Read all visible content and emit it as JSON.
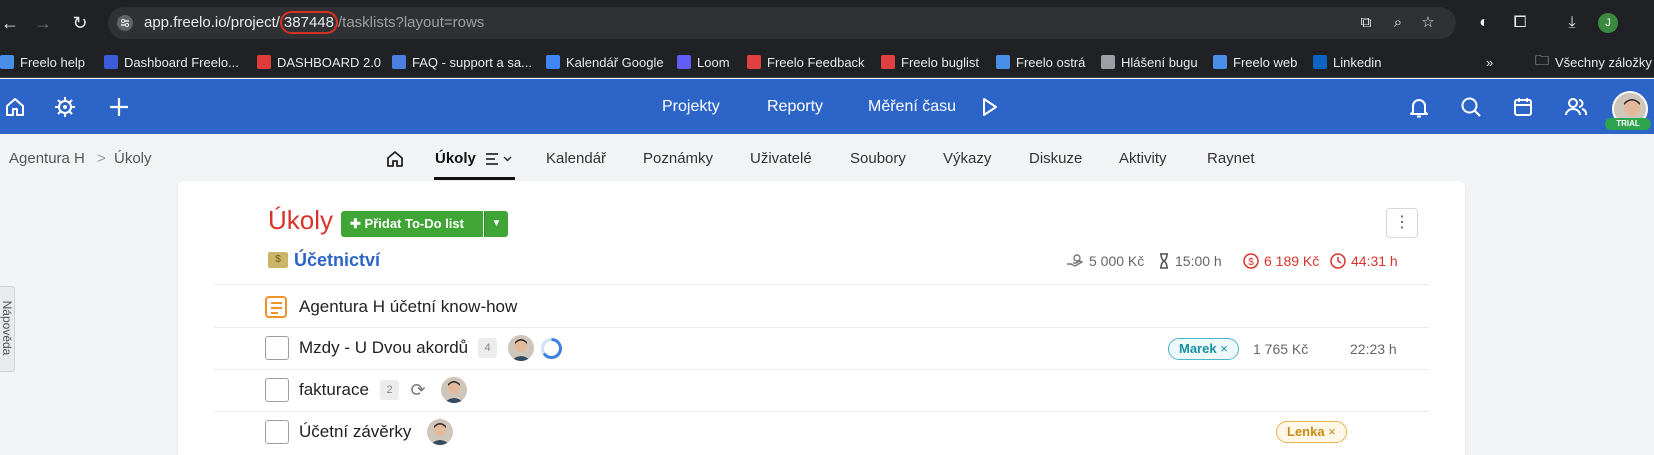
{
  "browser": {
    "url_prefix": "app.freelo.io/project/",
    "url_highlight": "387448",
    "url_suffix": "/tasklists?layout=rows",
    "profile_initial": "J",
    "bookmarks": [
      {
        "label": "Freelo help",
        "color": "#4a8fe7"
      },
      {
        "label": "Dashboard Freelo...",
        "color": "#3b5bd9"
      },
      {
        "label": "DASHBOARD 2.0",
        "color": "#e03b3b"
      },
      {
        "label": "FAQ - support a sa...",
        "color": "#4a7fe0"
      },
      {
        "label": "Kalendář Google",
        "color": "#4285f4"
      },
      {
        "label": "Loom",
        "color": "#625df5"
      },
      {
        "label": "Freelo Feedback",
        "color": "#e04040"
      },
      {
        "label": "Freelo buglist",
        "color": "#e04040"
      },
      {
        "label": "Freelo ostrá",
        "color": "#4a8fe7"
      },
      {
        "label": "Hlášení bugu",
        "color": "#9aa0a6"
      },
      {
        "label": "Freelo web",
        "color": "#4a8fe7"
      },
      {
        "label": "Linkedin",
        "color": "#0a66c2"
      }
    ],
    "all_bookmarks": "Všechny záložky"
  },
  "header": {
    "links": [
      "Projekty",
      "Reporty",
      "Měření času"
    ],
    "trial_label": "TRIAL"
  },
  "breadcrumb": {
    "project": "Agentura H",
    "separator": ">",
    "current": "Úkoly"
  },
  "tabs": [
    "Úkoly",
    "Kalendář",
    "Poznámky",
    "Uživatelé",
    "Soubory",
    "Výkazy",
    "Diskuze",
    "Aktivity",
    "Raynet"
  ],
  "help_tab": "Nápověda",
  "main": {
    "title": "Úkoly",
    "add_button": "Přidat To-Do list",
    "tasklist": {
      "emoji": "💵",
      "name": "Účetnictví",
      "budget": "5 000 Kč",
      "estimate": "15:00 h",
      "cost": "6 189 Kč",
      "time_spent": "44:31 h"
    },
    "note": "Agentura H účetní know-how",
    "tasks": [
      {
        "name": "Mzdy - U Dvou akordů",
        "count": "4",
        "tag": "Marek",
        "amount": "1 765 Kč",
        "time": "22:23 h"
      },
      {
        "name": "fakturace",
        "count": "2"
      },
      {
        "name": "Účetní závěrky",
        "tag": "Lenka"
      }
    ]
  },
  "colors": {
    "brand_blue": "#2d64c8",
    "title_red": "#d9342b",
    "button_green": "#3fa535"
  }
}
